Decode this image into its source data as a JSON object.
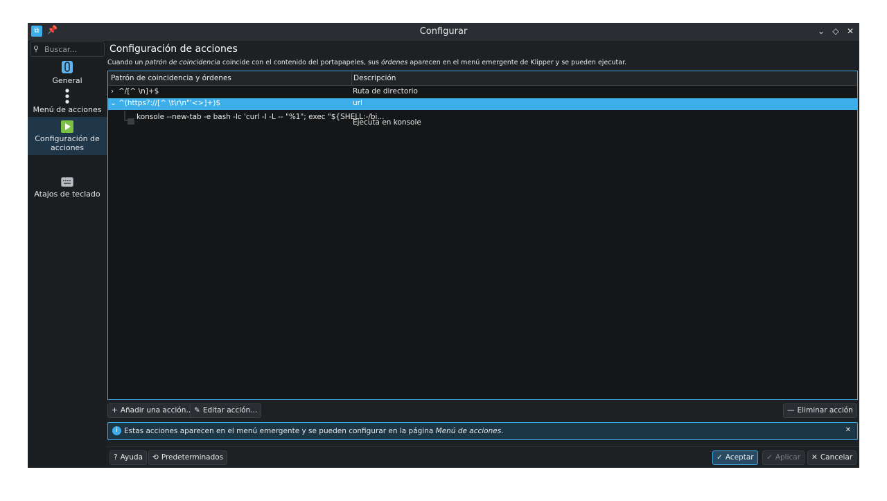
{
  "window": {
    "title": "Configurar",
    "icons": [
      "klipper-app-icon",
      "pin-icon",
      "minimize-icon",
      "maximize-icon",
      "close-icon"
    ]
  },
  "sidebar": {
    "search_placeholder": "Buscar...",
    "categories": [
      {
        "label": "General",
        "icon": "clipboard-icon",
        "selected": false
      },
      {
        "label": "Menú de acciones",
        "icon": "vertical-dots-icon",
        "selected": false
      },
      {
        "label": "Configuración de acciones",
        "icon": "play-icon",
        "selected": true
      },
      {
        "label": "Atajos de teclado",
        "icon": "keyboard-icon",
        "selected": false
      }
    ]
  },
  "page": {
    "title": "Configuración de acciones",
    "description": {
      "part1": "Cuando un ",
      "em1": "patrón de coincidencia",
      "part2": " coincide con el contenido del portapapeles, sus ",
      "em2": "órdenes",
      "part3": " aparecen en el menú emergente de Klipper y se pueden ejecutar."
    }
  },
  "actions_table": {
    "columns": [
      "Patrón de coincidencia y órdenes",
      "Descripción"
    ],
    "rows": [
      {
        "pattern": "^/[^ \\n]+$",
        "description": "Ruta de directorio",
        "expanded": false,
        "selected": false
      },
      {
        "pattern": "^(https?://[^ \\t\\r\\n\"'<>]+)$",
        "description": "url",
        "expanded": true,
        "selected": true
      },
      {
        "pattern": "konsole --new-tab -e bash -lc 'curl -I -L -- \"%1\"; exec \"${SHELL:-/bi...",
        "description": "Ejecuta en konsole",
        "child": true
      }
    ]
  },
  "buttons": {
    "add_action": "Añadir una acción...",
    "edit_action": "Editar acción...",
    "delete_action": "Eliminar acción",
    "help": "Ayuda",
    "defaults": "Predeterminados",
    "accept": "Aceptar",
    "apply": "Aplicar",
    "cancel": "Cancelar"
  },
  "message": {
    "text_part1": "Estas acciones aparecen en el menú emergente y se pueden configurar en la página ",
    "text_em": "Menú de acciones",
    "text_part2": "."
  },
  "colors": {
    "accent": "#3daee9",
    "window_bg": "#1e2124",
    "selection_bg": "#3daee9",
    "play_icon_green": "#7bc043"
  }
}
